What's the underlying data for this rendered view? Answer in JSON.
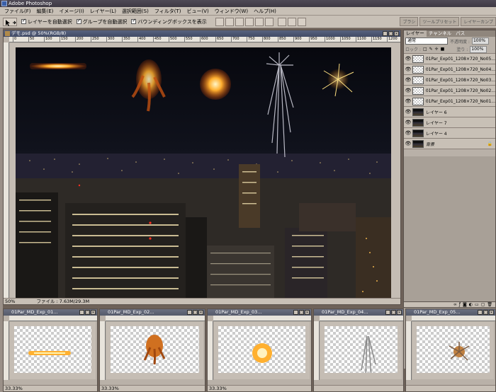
{
  "app": {
    "title": "Adobe Photoshop"
  },
  "menu": [
    "ファイル(F)",
    "編集(E)",
    "イメージ(I)",
    "レイヤー(L)",
    "選択範囲(S)",
    "フィルタ(T)",
    "ビュー(V)",
    "ウィンドウ(W)",
    "ヘルプ(H)"
  ],
  "options": {
    "auto_select_layer": "レイヤーを自動選択",
    "auto_select_group": "グループを自動選択",
    "bounding_box": "バウンディングボックスを表示"
  },
  "palette_well": [
    "ブラシ",
    "ツールプリセット",
    "レイヤーカンプ"
  ],
  "main_doc": {
    "title": "デモ.psd @ 50%(RGB/8)",
    "zoom": "50%",
    "file_info": "ファイル : 7.63M/29.3M",
    "ruler_ticks": [
      "0",
      "50",
      "100",
      "150",
      "200",
      "250",
      "300",
      "350",
      "400",
      "450",
      "500",
      "550",
      "600",
      "650",
      "700",
      "750",
      "800",
      "850",
      "900",
      "950",
      "1000",
      "1050",
      "1100",
      "1150",
      "1200"
    ]
  },
  "layers_panel": {
    "tabs": [
      "レイヤー",
      "チャンネル",
      "パス"
    ],
    "blend_mode": "通常",
    "opacity_label": "不透明度 :",
    "opacity": "100%",
    "lock_label": "ロック :",
    "fill_label": "塗り :",
    "fill": "100%",
    "layers": [
      {
        "name": "01Par_Exp01_1208×720_No05...",
        "thumb": "chk"
      },
      {
        "name": "01Par_Exp01_1208×720_No04...",
        "thumb": "chk"
      },
      {
        "name": "01Par_Exp01_1208×720_No03...",
        "thumb": "chk"
      },
      {
        "name": "01Par_Exp01_1208×720_No02...",
        "thumb": "chk"
      },
      {
        "name": "01Par_Exp01_1208×720_No01...",
        "thumb": "chk"
      },
      {
        "name": "レイヤー 6",
        "thumb": "city"
      },
      {
        "name": "レイヤー 7",
        "thumb": "city"
      },
      {
        "name": "レイヤー 4",
        "thumb": "city"
      },
      {
        "name": "背景",
        "thumb": "city"
      }
    ]
  },
  "thumb_docs": [
    {
      "title": "01Par_MD_Exp_01...",
      "zoom": "33.33%"
    },
    {
      "title": "01Par_MD_Exp_02...",
      "zoom": "33.33%"
    },
    {
      "title": "01Par_MD_Exp_03...",
      "zoom": "33.33%"
    },
    {
      "title": "01Par_MD_Exp_04...",
      "zoom": ""
    },
    {
      "title": "01Par_MD_Exp_05...",
      "zoom": ""
    }
  ],
  "colors": {
    "titlebar": "#3e3944",
    "doc_titlebar": "#424b66",
    "chrome": "#c8c0b6",
    "workspace": "#6e6259"
  }
}
